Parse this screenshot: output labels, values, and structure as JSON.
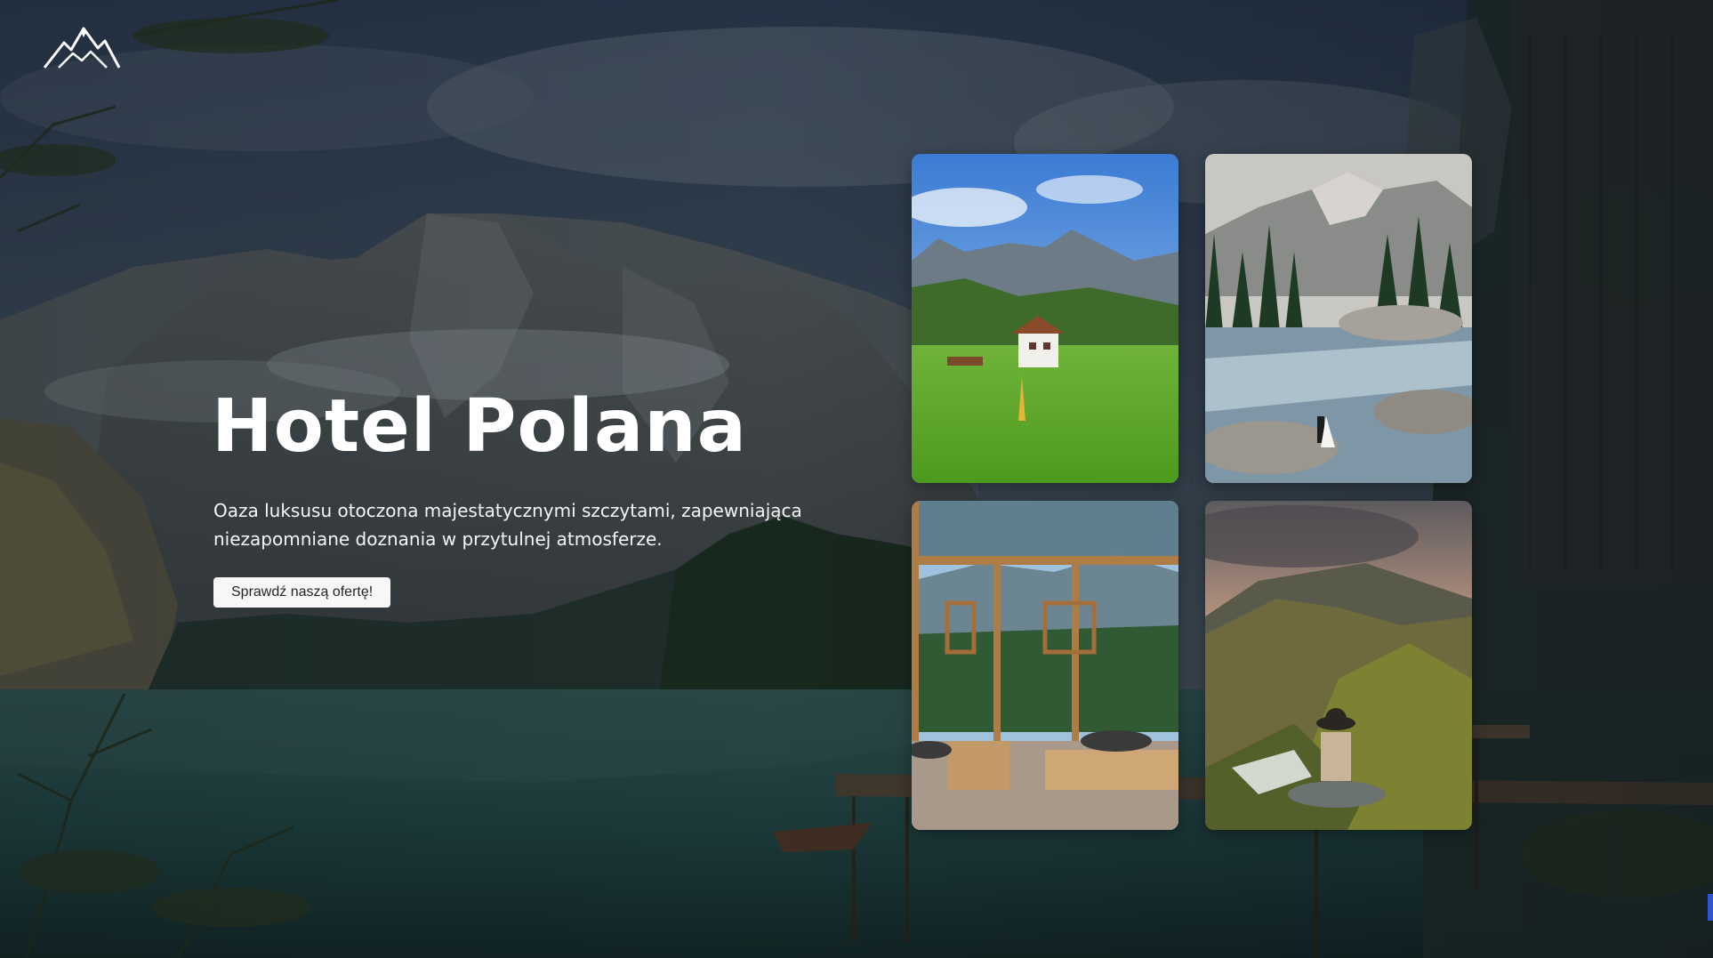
{
  "hotel": {
    "name": "Hotel Polana",
    "description": "Oaza luksusu otoczona majestatycznymi szczytami, zapewniająca niezapomniane doznania w przytulnej atmosferze.",
    "cta_label": "Sprawdź naszą ofertę!"
  },
  "logo": {
    "icon": "mountain-logo-icon"
  },
  "gallery": {
    "images": [
      {
        "name": "alpine-chalet-meadow",
        "icon": "photo-icon"
      },
      {
        "name": "mountain-river-couple",
        "icon": "photo-icon"
      },
      {
        "name": "open-wooden-pavilion",
        "icon": "photo-icon"
      },
      {
        "name": "hiker-mountain-valley",
        "icon": "photo-icon"
      }
    ]
  },
  "colors": {
    "button_bg": "#f7f7f7",
    "button_text": "#212529",
    "title": "#ffffff",
    "scroll_accent": "#2f55d4"
  }
}
